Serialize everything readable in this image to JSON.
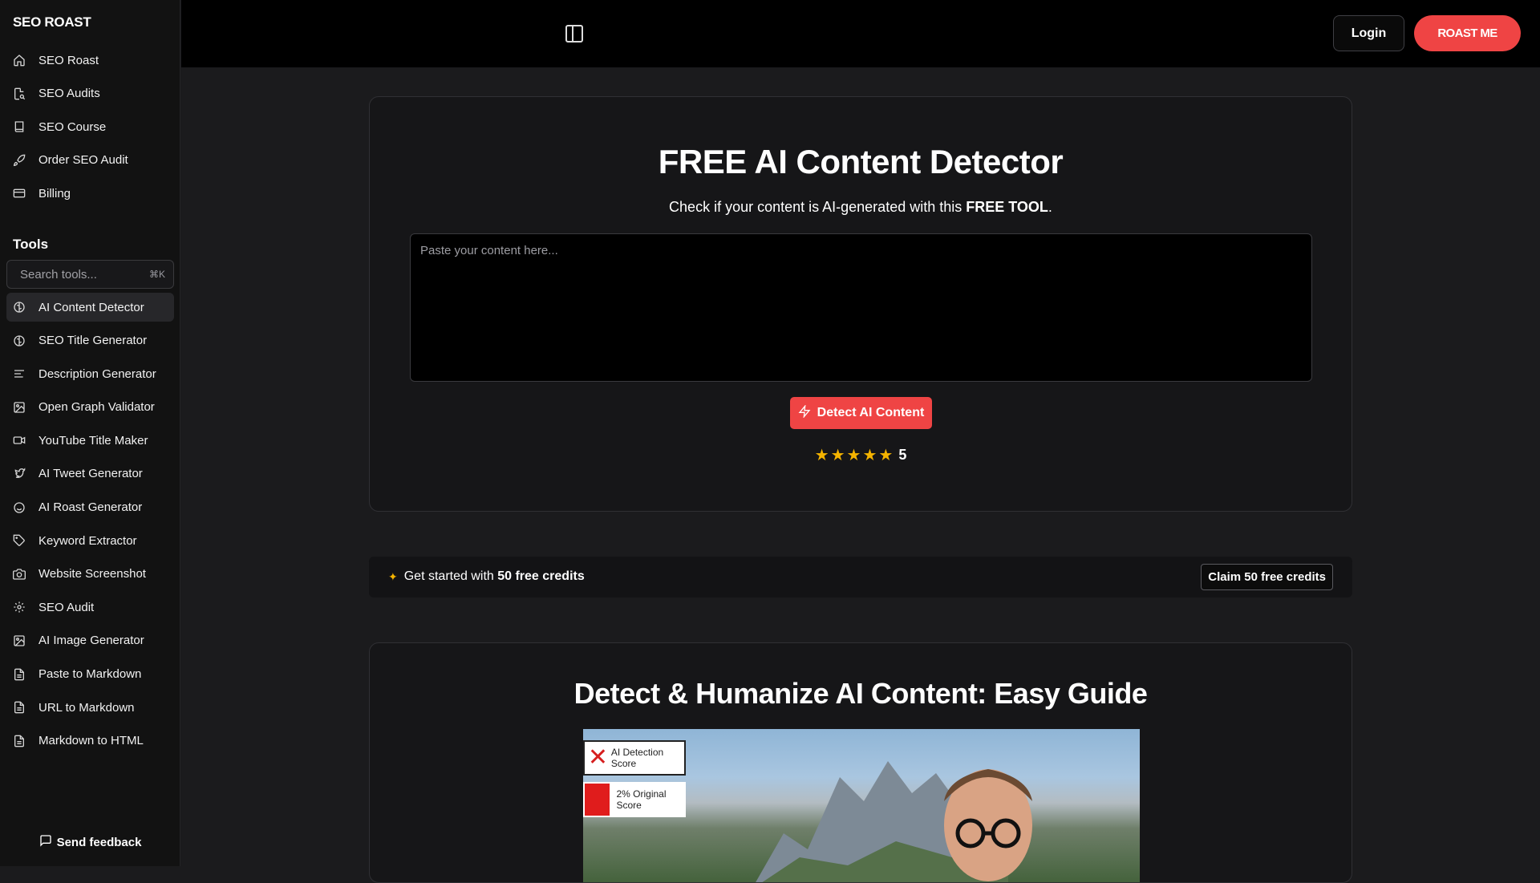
{
  "sidebar": {
    "brand": "SEO ROAST",
    "nav": [
      {
        "label": "SEO Roast",
        "icon": "home-icon"
      },
      {
        "label": "SEO Audits",
        "icon": "file-search-icon"
      },
      {
        "label": "SEO Course",
        "icon": "book-icon"
      },
      {
        "label": "Order SEO Audit",
        "icon": "rocket-icon"
      },
      {
        "label": "Billing",
        "icon": "credit-card-icon"
      }
    ],
    "tools_title": "Tools",
    "search": {
      "placeholder": "Search tools...",
      "shortcut": "⌘K"
    },
    "tools": [
      {
        "label": "AI Content Detector",
        "icon": "brain-icon",
        "active": true
      },
      {
        "label": "SEO Title Generator",
        "icon": "brain-icon"
      },
      {
        "label": "Description Generator",
        "icon": "align-left-icon"
      },
      {
        "label": "Open Graph Validator",
        "icon": "image-icon"
      },
      {
        "label": "YouTube Title Maker",
        "icon": "video-icon"
      },
      {
        "label": "AI Tweet Generator",
        "icon": "twitter-icon"
      },
      {
        "label": "AI Roast Generator",
        "icon": "smile-icon"
      },
      {
        "label": "Keyword Extractor",
        "icon": "tag-icon"
      },
      {
        "label": "Website Screenshot",
        "icon": "camera-icon"
      },
      {
        "label": "SEO Audit",
        "icon": "gear-icon"
      },
      {
        "label": "AI Image Generator",
        "icon": "image-icon"
      },
      {
        "label": "Paste to Markdown",
        "icon": "file-text-icon"
      },
      {
        "label": "URL to Markdown",
        "icon": "file-text-icon"
      },
      {
        "label": "Markdown to HTML",
        "icon": "file-text-icon"
      }
    ],
    "feedback": "Send feedback"
  },
  "header": {
    "login": "Login",
    "cta": "ROAST ME"
  },
  "detector": {
    "title": "FREE AI Content Detector",
    "subtitle_prefix": "Check if your content is AI-generated with this ",
    "subtitle_bold": "FREE TOOL",
    "subtitle_suffix": ".",
    "placeholder": "Paste your content here...",
    "button": "Detect AI Content",
    "rating": "5"
  },
  "credits": {
    "text_prefix": "Get started with ",
    "text_bold": "50 free credits",
    "button": "Claim 50 free credits"
  },
  "guide": {
    "title": "Detect & Humanize AI Content: Easy Guide",
    "badge1": "AI Detection Score",
    "badge2": "2% Original Score"
  },
  "colors": {
    "accent": "#ef4444",
    "star": "#f5b400",
    "background": "#1b1b1d"
  }
}
